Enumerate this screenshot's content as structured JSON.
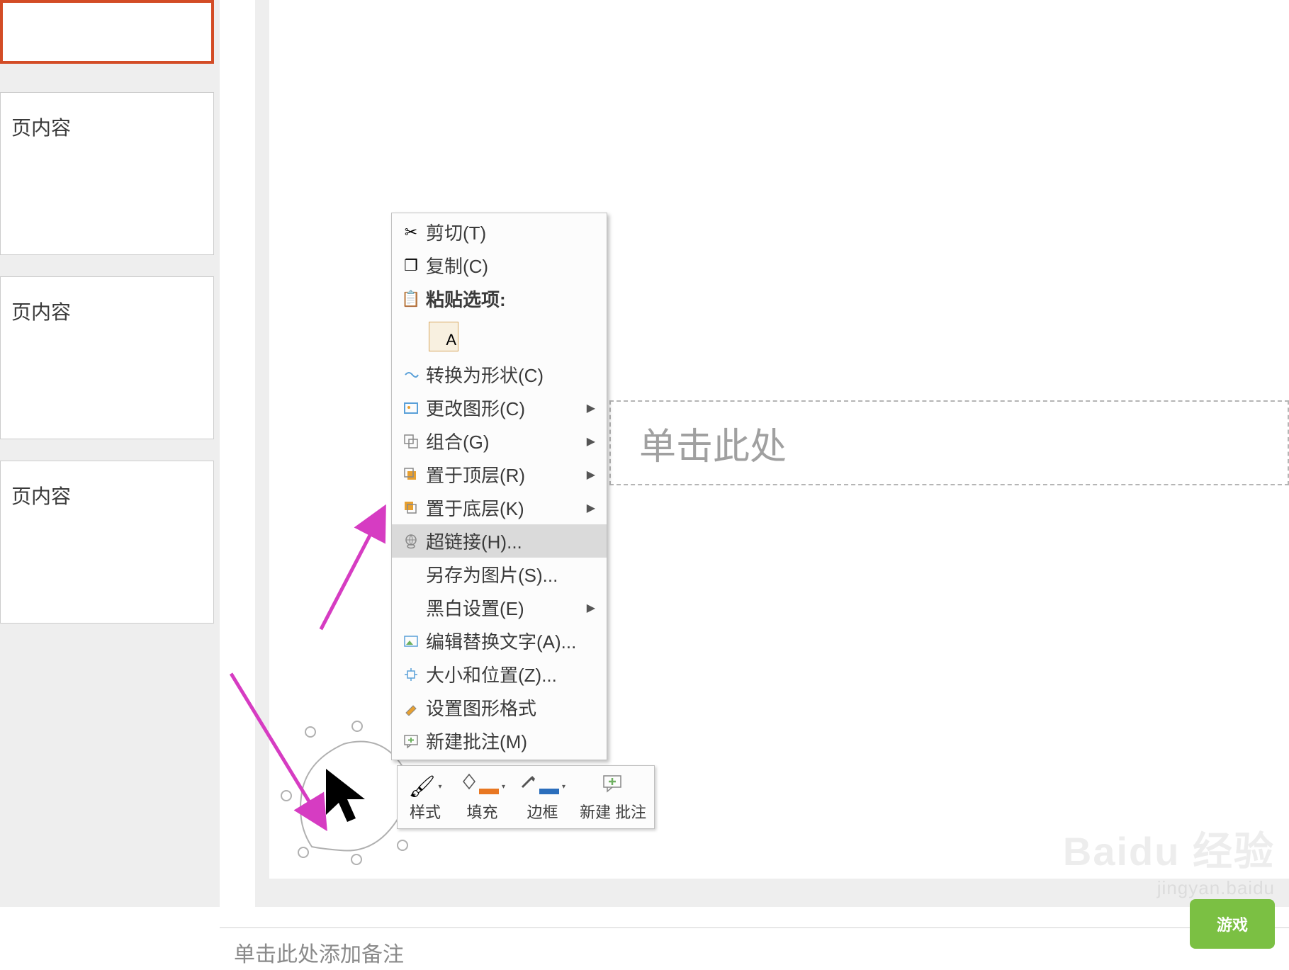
{
  "sidebar": {
    "thumbnails": [
      {
        "label": ""
      },
      {
        "label": "页内容"
      },
      {
        "label": "页内容"
      },
      {
        "label": "页内容"
      }
    ]
  },
  "slide": {
    "title_placeholder": "单击此处"
  },
  "contextMenu": {
    "items": [
      {
        "label": "剪切(T)",
        "icon": "scissors"
      },
      {
        "label": "复制(C)",
        "icon": "copy"
      },
      {
        "label": "粘贴选项:",
        "icon": "paste",
        "header": true
      },
      {
        "label": "转换为形状(C)",
        "icon": "convert"
      },
      {
        "label": "更改图形(C)",
        "icon": "change",
        "submenu": true
      },
      {
        "label": "组合(G)",
        "icon": "group",
        "submenu": true
      },
      {
        "label": "置于顶层(R)",
        "icon": "bringfront",
        "submenu": true
      },
      {
        "label": "置于底层(K)",
        "icon": "sendback",
        "submenu": true
      },
      {
        "label": "超链接(H)...",
        "icon": "hyperlink",
        "highlighted": true
      },
      {
        "label": "另存为图片(S)...",
        "icon": "none"
      },
      {
        "label": "黑白设置(E)",
        "icon": "none",
        "submenu": true
      },
      {
        "label": "编辑替换文字(A)...",
        "icon": "alttext"
      },
      {
        "label": "大小和位置(Z)...",
        "icon": "size"
      },
      {
        "label": "设置图形格式",
        "icon": "format"
      },
      {
        "label": "新建批注(M)",
        "icon": "comment"
      }
    ],
    "pasteOption": "A"
  },
  "miniToolbar": {
    "buttons": [
      {
        "label": "样式",
        "icon": "brush"
      },
      {
        "label": "填充",
        "icon": "fill"
      },
      {
        "label": "边框",
        "icon": "border"
      },
      {
        "label": "新建\n批注",
        "icon": "comment"
      }
    ]
  },
  "notesPanel": {
    "placeholder": "单击此处添加备注"
  },
  "watermark": {
    "logo": "Baidu 经验",
    "url": "jingyan.baidu",
    "badge": "游戏"
  }
}
